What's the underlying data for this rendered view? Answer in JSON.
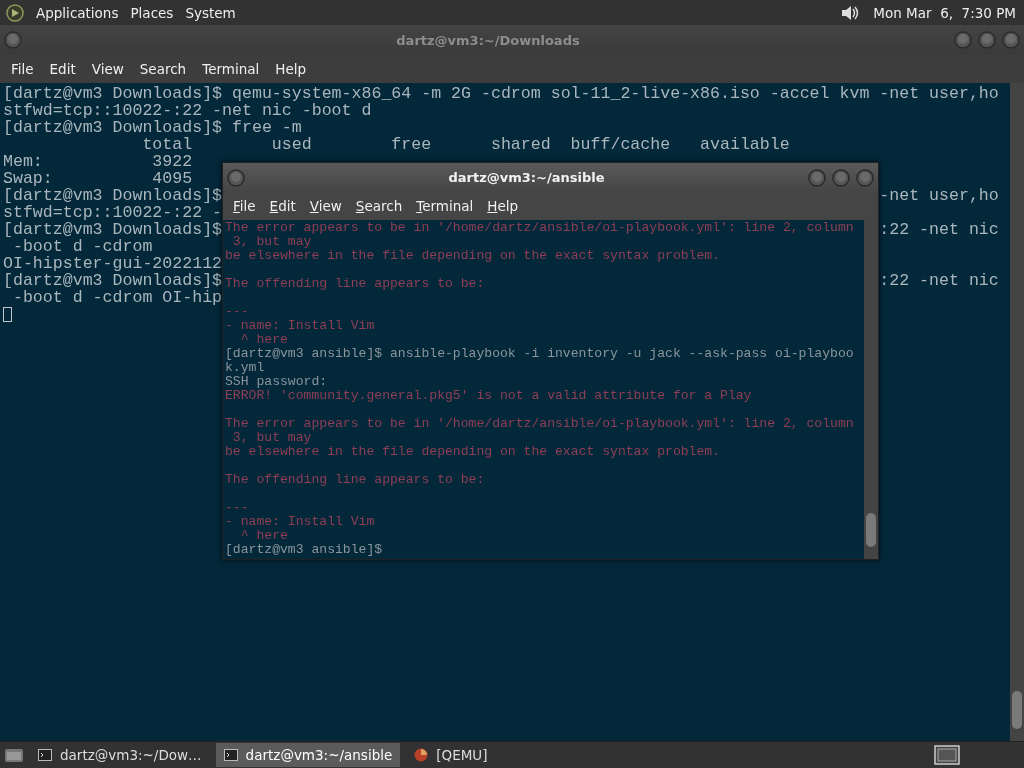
{
  "top_panel": {
    "menus": [
      "Applications",
      "Places",
      "System"
    ],
    "clock": "Mon Mar  6,  7:30 PM"
  },
  "back_window": {
    "title": "dartz@vm3:~/Downloads",
    "active": false,
    "menu": [
      "File",
      "Edit",
      "View",
      "Search",
      "Terminal",
      "Help"
    ],
    "lines": [
      {
        "left": "[dartz@vm3 Downloads]$ qemu-system-x86_64 -m 2G -cdrom sol-11_2-live-x86.iso -accel kvm -net user,ho"
      },
      {
        "left": "stfwd=tcp::10022-:22 -net nic -boot d"
      },
      {
        "left": "[dartz@vm3 Downloads]$ free -m"
      },
      {
        "left": "              total        used        free      shared  buff/cache   available"
      },
      {
        "left": "Mem:           3922"
      },
      {
        "left": "Swap:          4095"
      },
      {
        "left": "[dartz@vm3 Downloads]$",
        "right": "-net user,ho"
      },
      {
        "left": "stfwd=tcp::10022-:22 -"
      },
      {
        "left": "[dartz@vm3 Downloads]$",
        "right": ":22 -net nic"
      },
      {
        "left": " -boot d -cdrom"
      },
      {
        "left": "OI-hipster-gui-2022112"
      },
      {
        "left": "[dartz@vm3 Downloads]$",
        "right": ":22 -net nic"
      },
      {
        "left": " -boot d -cdrom OI-hip"
      }
    ],
    "cursor": true
  },
  "front_window": {
    "title": "dartz@vm3:~/ansible",
    "active": true,
    "menu": [
      "File",
      "Edit",
      "View",
      "Search",
      "Terminal",
      "Help"
    ],
    "lines": [
      {
        "kind": "error",
        "text": "The error appears to be in '/home/dartz/ansible/oi-playbook.yml': line 2, column"
      },
      {
        "kind": "error",
        "text": " 3, but may"
      },
      {
        "kind": "error",
        "text": "be elsewhere in the file depending on the exact syntax problem."
      },
      {
        "kind": "blank"
      },
      {
        "kind": "error",
        "text": "The offending line appears to be:"
      },
      {
        "kind": "blank"
      },
      {
        "kind": "error",
        "text": "---"
      },
      {
        "kind": "error",
        "text": "- name: Install Vim"
      },
      {
        "kind": "error",
        "text": "  ^ here"
      },
      {
        "kind": "output",
        "text": "[dartz@vm3 ansible]$ ansible-playbook -i inventory -u jack --ask-pass oi-playboo"
      },
      {
        "kind": "output",
        "text": "k.yml"
      },
      {
        "kind": "output",
        "text": "SSH password:"
      },
      {
        "kind": "error",
        "text": "ERROR! 'community.general.pkg5' is not a valid attribute for a Play"
      },
      {
        "kind": "blank"
      },
      {
        "kind": "error",
        "text": "The error appears to be in '/home/dartz/ansible/oi-playbook.yml': line 2, column"
      },
      {
        "kind": "error",
        "text": " 3, but may"
      },
      {
        "kind": "error",
        "text": "be elsewhere in the file depending on the exact syntax problem."
      },
      {
        "kind": "blank"
      },
      {
        "kind": "error",
        "text": "The offending line appears to be:"
      },
      {
        "kind": "blank"
      },
      {
        "kind": "error",
        "text": "---"
      },
      {
        "kind": "error",
        "text": "- name: Install Vim"
      },
      {
        "kind": "error",
        "text": "  ^ here"
      },
      {
        "kind": "output",
        "text": "[dartz@vm3 ansible]$"
      }
    ]
  },
  "taskbar": {
    "tasks": [
      {
        "kind": "terminal",
        "label": "dartz@vm3:~/Dow…",
        "selected": false
      },
      {
        "kind": "terminal",
        "label": "dartz@vm3:~/ansible",
        "selected": true
      },
      {
        "kind": "app",
        "label": "[QEMU]",
        "selected": false
      }
    ]
  }
}
